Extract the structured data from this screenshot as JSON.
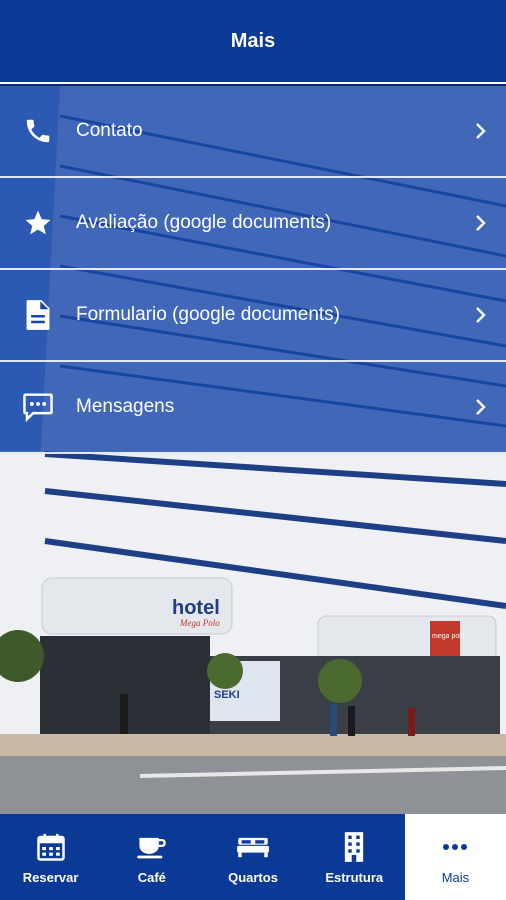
{
  "header": {
    "title": "Mais"
  },
  "menu": {
    "items": [
      {
        "label": "Contato",
        "icon": "phone-icon"
      },
      {
        "label": "Avaliação (google documents)",
        "icon": "star-icon"
      },
      {
        "label": "Formulario (google documents)",
        "icon": "document-icon"
      },
      {
        "label": "Mensagens",
        "icon": "message-icon"
      }
    ]
  },
  "photo": {
    "building_sign": "hotel",
    "building_sign_sub": "Mega Polo",
    "store_sign": "mega polo",
    "shop_sign": "SEKI"
  },
  "tabbar": {
    "tabs": [
      {
        "label": "Reservar",
        "icon": "calendar-icon",
        "active": false
      },
      {
        "label": "Café",
        "icon": "coffee-icon",
        "active": false
      },
      {
        "label": "Quartos",
        "icon": "bed-icon",
        "active": false
      },
      {
        "label": "Estrutura",
        "icon": "building-icon",
        "active": false
      },
      {
        "label": "Mais",
        "icon": "more-icon",
        "active": true
      }
    ]
  },
  "colors": {
    "primary": "#0b3a96",
    "overlay": "#1646aa",
    "text_light": "#ffffff"
  }
}
